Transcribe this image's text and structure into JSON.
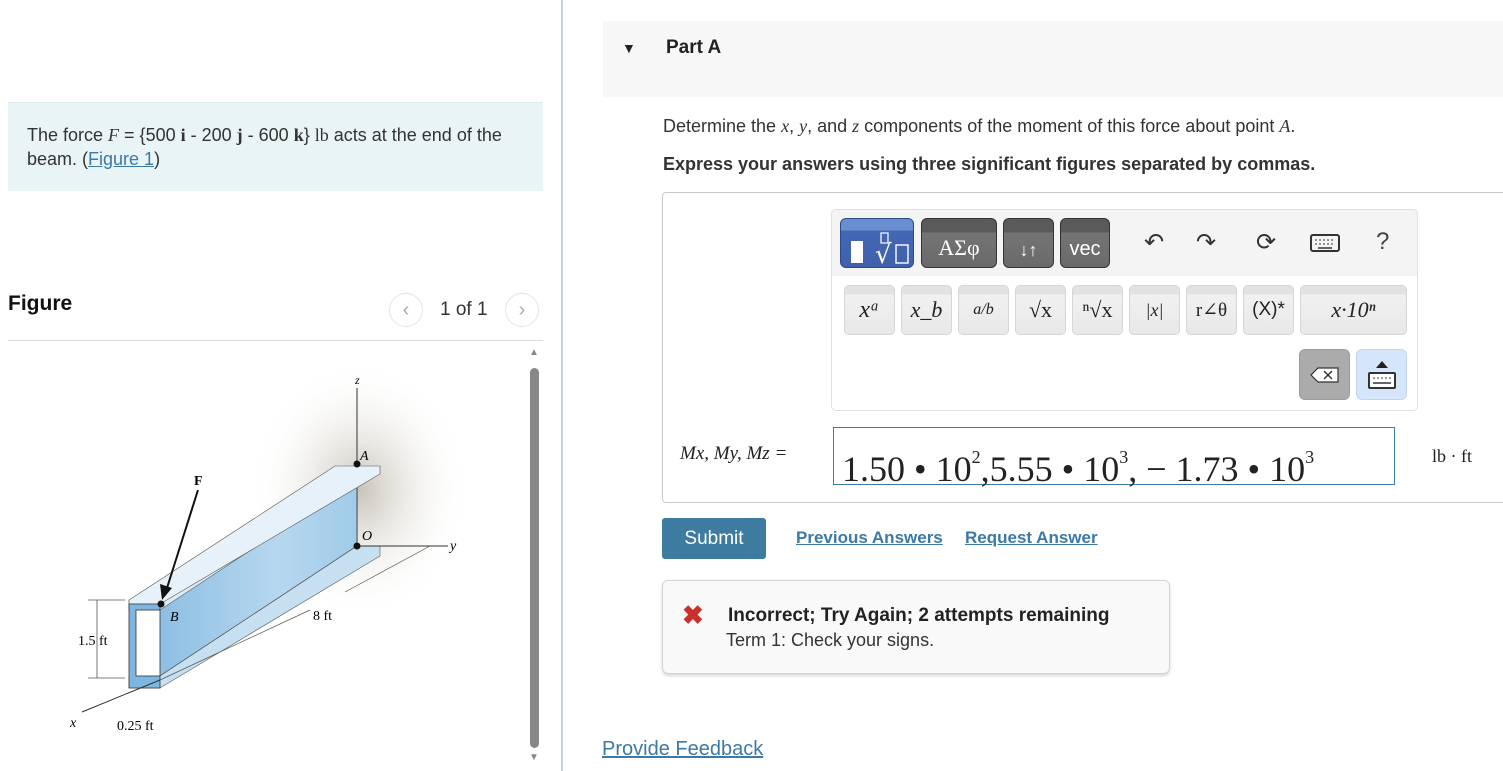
{
  "problem": {
    "text_prefix": "The force ",
    "force_symbol": "F",
    "eq": " = {500 ",
    "i": "i",
    "mid1": " - 200 ",
    "j": "j",
    "mid2": " - 600 ",
    "k": "k",
    "close": "} ",
    "unit": "lb",
    "text_suffix": " acts at the end of the beam. (",
    "figure_link": "Figure 1",
    "paren_close": ")"
  },
  "figure": {
    "title": "Figure",
    "pager_text": "1 of 1",
    "prev_icon": "chevron-left-icon",
    "next_icon": "chevron-right-icon",
    "labels": {
      "z": "z",
      "A": "A",
      "F": "F",
      "O": "O",
      "y": "y",
      "B": "B",
      "len": "8 ft",
      "height": "1.5 ft",
      "x": "x",
      "thickness": "0.25 ft"
    }
  },
  "part": {
    "caret": "▼",
    "title": "Part A",
    "question_pre": "Determine the ",
    "x": "x",
    "c1": ", ",
    "y": "y",
    "c2": ", and ",
    "z": "z",
    "question_post": " components of the moment of this force about point ",
    "A": "A",
    "period": ".",
    "instructions": "Express your answers using three significant figures separated by commas."
  },
  "toolbar": {
    "templates_icon": "templates-icon",
    "greek": "ΑΣφ",
    "arrows": "↓↑",
    "vec": "vec",
    "undo_icon": "undo-icon",
    "redo_icon": "redo-icon",
    "reset_icon": "reset-icon",
    "keyboard_icon": "keyboard-icon",
    "help": "?",
    "keys": [
      "xᵃ",
      "x_b",
      "a/b",
      "√x",
      "ⁿ√x",
      "|x|",
      "r∠θ",
      "(X)*",
      "x·10ⁿ"
    ],
    "backspace_icon": "backspace-icon",
    "kbd_toggle_icon": "keyboard-toggle-icon"
  },
  "answer": {
    "label": "Mx, My, Mz =",
    "value_parts": [
      "1.50 • 10",
      "2",
      ",5.55 • 10",
      "3",
      ", − 1.73 • 10",
      "3"
    ],
    "unit": "lb · ft"
  },
  "actions": {
    "submit": "Submit",
    "previous_answers": "Previous Answers",
    "request_answer": "Request Answer"
  },
  "feedback": {
    "icon": "✖",
    "title": "Incorrect; Try Again; 2 attempts remaining",
    "detail": "Term 1: Check your signs."
  },
  "footer": {
    "provide_feedback": "Provide Feedback"
  },
  "colors": {
    "link": "#3b79a8",
    "submit": "#3e7ba0",
    "error": "#c9302c",
    "problem_bg": "#e8f4f5"
  }
}
